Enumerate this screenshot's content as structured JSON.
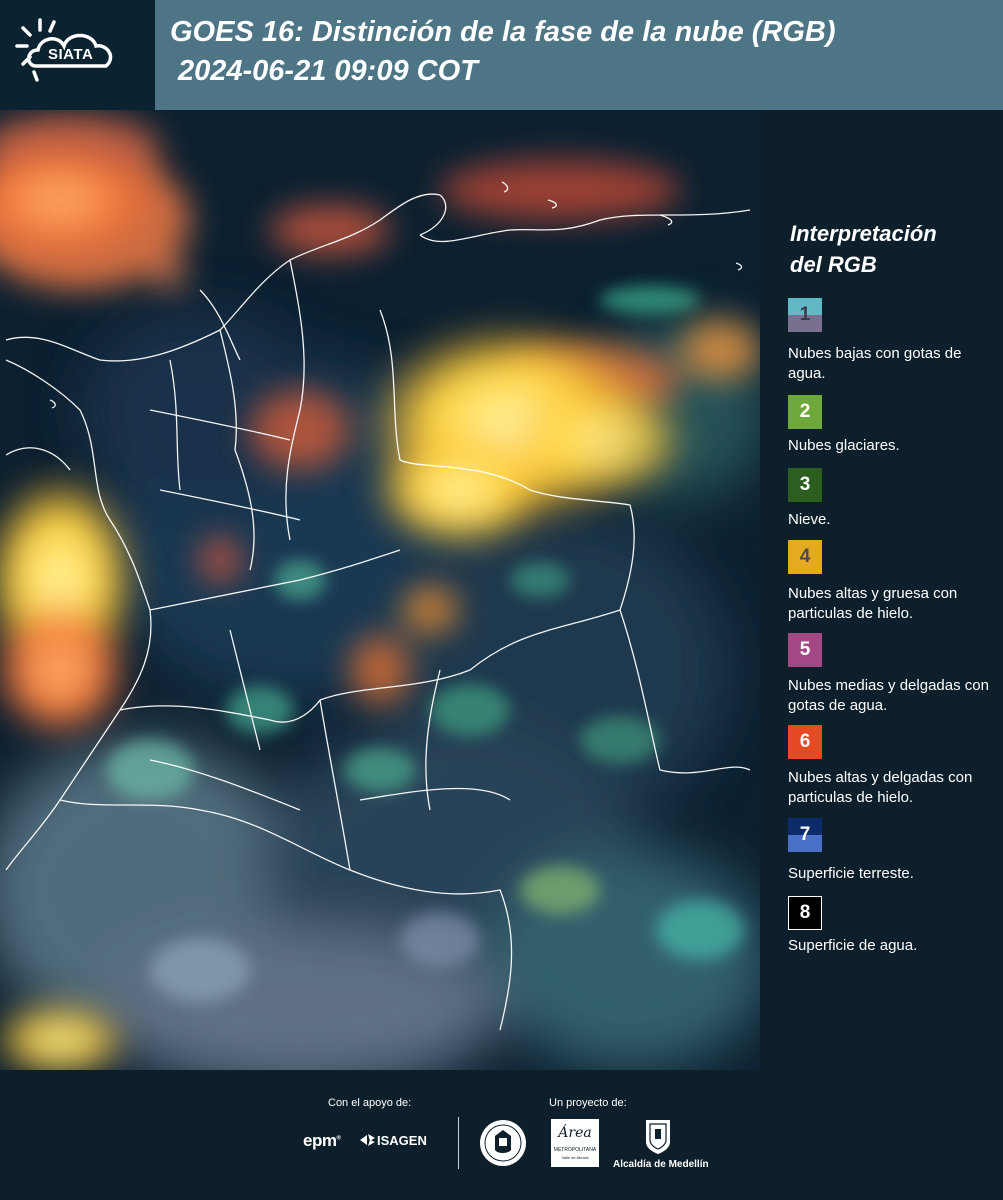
{
  "header": {
    "logo_text": "SIATA",
    "title_line1": "GOES 16: Distinción de la fase de la nube (RGB)",
    "title_line2": "2024-06-21 09:09 COT"
  },
  "legend": {
    "title_line1": "Interpretación",
    "title_line2": "del RGB",
    "items": [
      {
        "number": "1",
        "label": "Nubes bajas con gotas de agua.",
        "color_top": "#63b8c6",
        "color_bottom": "#7a6f8e"
      },
      {
        "number": "2",
        "label": "Nubes glaciares.",
        "color_top": "#6fa83a",
        "color_bottom": "#6fa83a"
      },
      {
        "number": "3",
        "label": "Nieve.",
        "color_top": "#2c5e1f",
        "color_bottom": "#2c5e1f"
      },
      {
        "number": "4",
        "label": "Nubes altas y gruesa con particulas de hielo.",
        "color_top": "#e3aa22",
        "color_bottom": "#e3aa22"
      },
      {
        "number": "5",
        "label": "Nubes medias y delgadas con gotas de agua.",
        "color_top": "#a34a86",
        "color_bottom": "#a34a86"
      },
      {
        "number": "6",
        "label": "Nubes altas y delgadas con particulas de hielo.",
        "color_top": "#e54a22",
        "color_bottom": "#e54a22"
      },
      {
        "number": "7",
        "label": "Superficie terreste.",
        "color_top": "#0d2a6a",
        "color_bottom": "#4a6fc6"
      },
      {
        "number": "8",
        "label": "Superficie de agua.",
        "color_top": "#000000",
        "color_bottom": "#000000"
      }
    ]
  },
  "footer": {
    "support_label": "Con el apoyo de:",
    "project_label": "Un proyecto de:",
    "brand_epm": "epm",
    "brand_isagen": "ISAGEN",
    "brand_area": "Área",
    "brand_area_sub": "METROPOLITANA",
    "brand_area_sub2": "Valle de Aburrá",
    "brand_alcaldia": "Alcaldía de Medellín"
  }
}
